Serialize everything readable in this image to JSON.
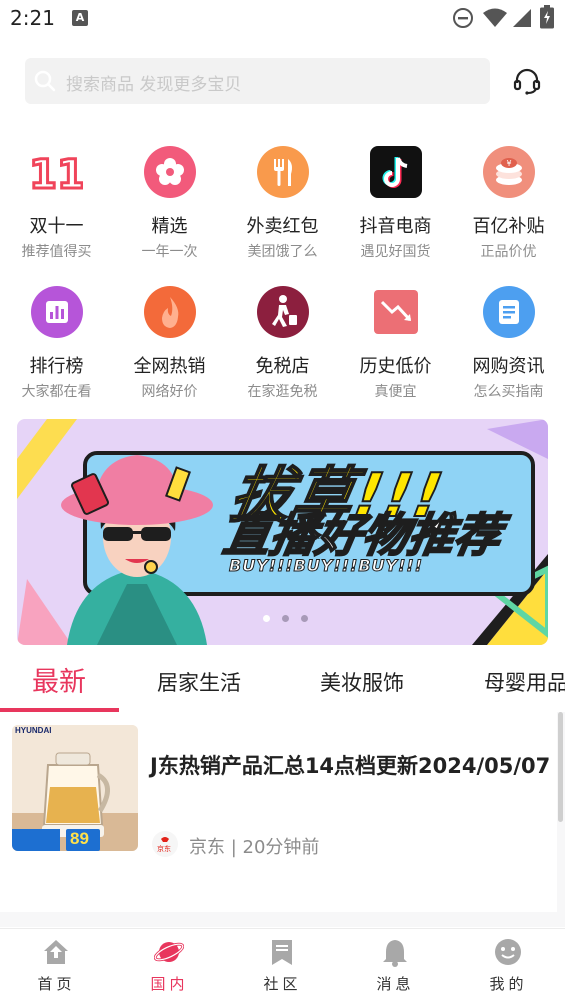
{
  "status_bar": {
    "time": "2:21",
    "app_badge": "A"
  },
  "search": {
    "placeholder": "搜索商品 发现更多宝贝"
  },
  "grid": [
    {
      "label": "双十一",
      "sub": "推荐值得买",
      "icon": "double-eleven-icon",
      "color": "#f0445a"
    },
    {
      "label": "精选",
      "sub": "一年一次",
      "icon": "star-flower-icon",
      "color": "#f25a7b"
    },
    {
      "label": "外卖红包",
      "sub": "美团饿了么",
      "icon": "fork-knife-icon",
      "color": "#f99a4c"
    },
    {
      "label": "抖音电商",
      "sub": "遇见好国货",
      "icon": "tiktok-icon",
      "color": "#111111"
    },
    {
      "label": "百亿补贴",
      "sub": "正品价优",
      "icon": "coin-stack-icon",
      "color": "#f08f7c"
    },
    {
      "label": "排行榜",
      "sub": "大家都在看",
      "icon": "bar-chart-icon",
      "color": "#b655d9"
    },
    {
      "label": "全网热销",
      "sub": "网络好价",
      "icon": "flame-icon",
      "color": "#f36a3a"
    },
    {
      "label": "免税店",
      "sub": "在家逛免税",
      "icon": "traveler-icon",
      "color": "#8c1f3e"
    },
    {
      "label": "历史低价",
      "sub": "真便宜",
      "icon": "trend-down-icon",
      "color": "#ec6f75"
    },
    {
      "label": "网购资讯",
      "sub": "怎么买指南",
      "icon": "document-icon",
      "color": "#4d9ff0"
    }
  ],
  "banner": {
    "title": "拔草!!!",
    "subtitle": "直播好物推荐",
    "tagline": "BUY!!!BUY!!!BUY!!!",
    "slide_count": 3,
    "active_slide": 1
  },
  "tabs": [
    {
      "label": "最新",
      "active": true
    },
    {
      "label": "居家生活",
      "active": false
    },
    {
      "label": "美妆服饰",
      "active": false
    },
    {
      "label": "母婴用品",
      "active": false
    }
  ],
  "feed": [
    {
      "title": "J东热销产品汇总14点档更新2024/05/07",
      "source": "京东",
      "time": "20分钟前",
      "meta": "京东 | 20分钟前",
      "thumb_brand": "HYUNDAI",
      "thumb_price": "89",
      "source_logo_text": "京东"
    }
  ],
  "bottom_nav": [
    {
      "label": "首页",
      "icon": "home-icon",
      "active": false
    },
    {
      "label": "国内",
      "icon": "planet-icon",
      "active": true
    },
    {
      "label": "社区",
      "icon": "bookmark-icon",
      "active": false
    },
    {
      "label": "消息",
      "icon": "bell-icon",
      "active": false
    },
    {
      "label": "我的",
      "icon": "smile-icon",
      "active": false
    }
  ],
  "colors": {
    "accent": "#e8365d",
    "muted": "#8c8c8c",
    "icon_grey": "#a8a8a8"
  }
}
